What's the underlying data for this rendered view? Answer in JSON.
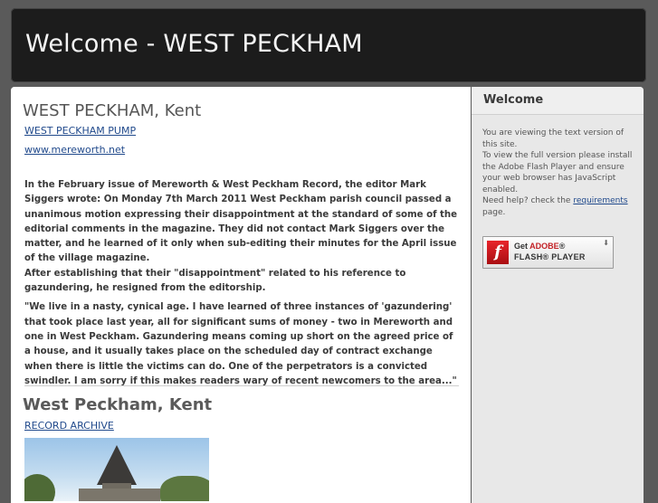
{
  "header": {
    "title": "Welcome - WEST PECKHAM"
  },
  "main": {
    "section1": {
      "title": "WEST PECKHAM, Kent",
      "link1": "WEST PECKHAM PUMP",
      "link2": "www.mereworth.net",
      "paragraph1": "In the February issue of Mereworth & West Peckham Record, the editor Mark Siggers wrote: On Monday 7th March 2011 West Peckham parish council passed a unanimous motion expressing their disappointment at the standard of some of the editorial comments in the magazine. They did not contact Mark Siggers over the matter, and he learned of it only when sub-editing their minutes for the April issue of the village magazine.",
      "paragraph2": "After establishing that their \"disappointment\" related to his reference to gazundering, he resigned from the editorship.",
      "paragraph3": "\"We live in a nasty, cynical age. I have learned of three instances of 'gazundering' that took place last year, all for significant sums of money - two in Mereworth and one in West Peckham. Gazundering means coming up short on the agreed price of a house, and it usually takes place on the scheduled day of contract exchange when there is little the victims can do. One of the perpetrators is a convicted swindler. I am sorry if this makes readers wary of recent newcomers to the area...\""
    },
    "section2": {
      "title": "West Peckham, Kent",
      "link": "RECORD ARCHIVE"
    }
  },
  "sidebar": {
    "title": "Welcome",
    "text1": "You are viewing the text version of this site.",
    "text2": "To view the full version please install the Adobe Flash Player and ensure your web browser has JavaScript enabled.",
    "text3_pre": "Need help? check the ",
    "text3_link": "requirements",
    "text3_post": " page.",
    "flash": {
      "get": "Get ",
      "brand": "ADOBE",
      "reg": "®",
      "product": "FLASH® PLAYER",
      "logo": "f"
    }
  }
}
